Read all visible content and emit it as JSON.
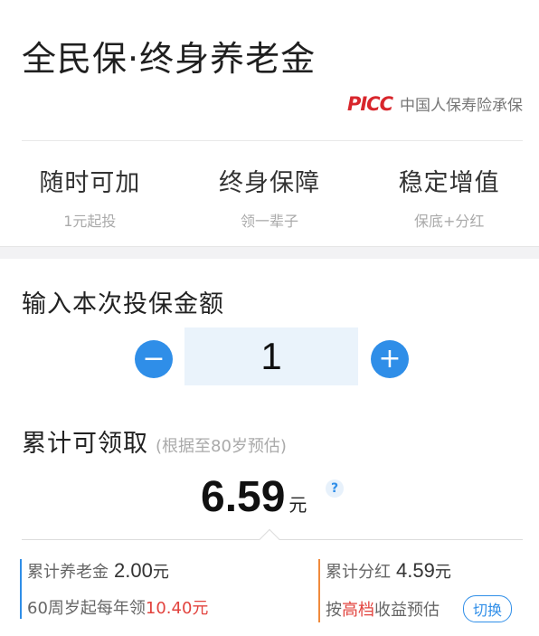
{
  "header": {
    "title": "全民保·终身养老金",
    "logo_text": "PICC",
    "underwriter": "中国人保寿险承保"
  },
  "features": [
    {
      "title": "随时可加",
      "subtitle": "1元起投"
    },
    {
      "title": "终身保障",
      "subtitle": "领一辈子"
    },
    {
      "title": "稳定增值",
      "subtitle": "保底+分红"
    }
  ],
  "investment": {
    "label": "输入本次投保金额",
    "amount": "1",
    "minus": "−",
    "plus": "+"
  },
  "summary": {
    "label": "累计可领取",
    "note": "(根据至80岁预估)",
    "value": "6.59",
    "unit": "元",
    "help": "?"
  },
  "details": {
    "pension_label": "累计养老金",
    "pension_value": "2.00",
    "pension_unit": "元",
    "annual_prefix": "60周岁起每年领",
    "annual_value": "10.40元",
    "dividend_label": "累计分红",
    "dividend_value": "4.59",
    "dividend_unit": "元",
    "estimate_prefix": "按",
    "estimate_tier": "高档",
    "estimate_suffix": "收益预估",
    "switch_label": "切换"
  },
  "colors": {
    "accent": "#2f8ee8",
    "brand_red": "#d8262c",
    "highlight_red": "#e2433e",
    "orange": "#f08a3c"
  }
}
